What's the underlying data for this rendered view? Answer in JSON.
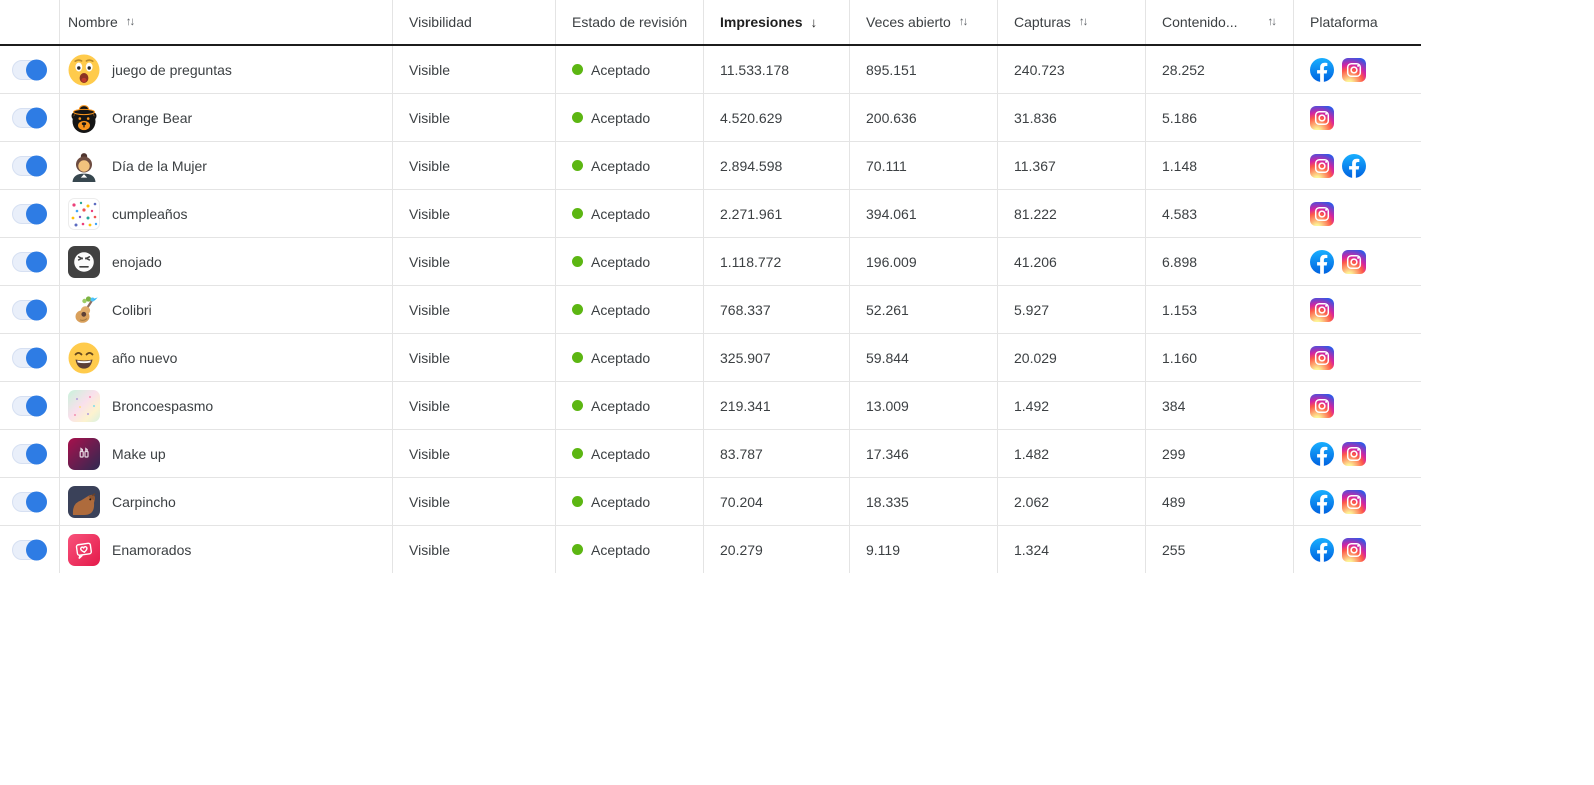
{
  "table": {
    "columns": [
      {
        "id": "nombre",
        "label": "Nombre",
        "sort": "both",
        "sortable": true
      },
      {
        "id": "visibilidad",
        "label": "Visibilidad",
        "sort": "none",
        "sortable": false
      },
      {
        "id": "estado-de-revision",
        "label": "Estado de revisión",
        "sort": "none",
        "sortable": false
      },
      {
        "id": "impresiones",
        "label": "Impresiones",
        "sort": "desc",
        "sortable": true,
        "active": true
      },
      {
        "id": "veces-abierto",
        "label": "Veces abierto",
        "sort": "both",
        "sortable": true
      },
      {
        "id": "capturas",
        "label": "Capturas",
        "sort": "both",
        "sortable": true
      },
      {
        "id": "contenido",
        "label": "Contenido...",
        "sort": "both",
        "sortable": true,
        "sort_right": true
      },
      {
        "id": "plataforma",
        "label": "Plataforma",
        "sort": "none",
        "sortable": false
      }
    ],
    "rows": [
      {
        "enabled": true,
        "avatar": "astonished-face",
        "name": "juego de preguntas",
        "visibility": "Visible",
        "status": "Aceptado",
        "impressions": "11.533.178",
        "opens": "895.151",
        "captures": "240.723",
        "content": "28.252",
        "platforms": [
          "facebook",
          "instagram"
        ]
      },
      {
        "enabled": true,
        "avatar": "orange-bear",
        "name": "Orange Bear",
        "visibility": "Visible",
        "status": "Aceptado",
        "impressions": "4.520.629",
        "opens": "200.636",
        "captures": "31.836",
        "content": "5.186",
        "platforms": [
          "instagram"
        ]
      },
      {
        "enabled": true,
        "avatar": "businesswoman",
        "name": "Día de la Mujer",
        "visibility": "Visible",
        "status": "Aceptado",
        "impressions": "2.894.598",
        "opens": "70.111",
        "captures": "11.367",
        "content": "1.148",
        "platforms": [
          "instagram",
          "facebook"
        ]
      },
      {
        "enabled": true,
        "avatar": "confetti",
        "name": "cumpleaños",
        "visibility": "Visible",
        "status": "Aceptado",
        "impressions": "2.271.961",
        "opens": "394.061",
        "captures": "81.222",
        "content": "4.583",
        "platforms": [
          "instagram"
        ]
      },
      {
        "enabled": true,
        "avatar": "angry-face",
        "name": "enojado",
        "visibility": "Visible",
        "status": "Aceptado",
        "impressions": "1.118.772",
        "opens": "196.009",
        "captures": "41.206",
        "content": "6.898",
        "platforms": [
          "facebook",
          "instagram"
        ]
      },
      {
        "enabled": true,
        "avatar": "guitar-hummingbird",
        "name": "Colibri",
        "visibility": "Visible",
        "status": "Aceptado",
        "impressions": "768.337",
        "opens": "52.261",
        "captures": "5.927",
        "content": "1.153",
        "platforms": [
          "instagram"
        ]
      },
      {
        "enabled": true,
        "avatar": "laughing-face",
        "name": "año nuevo",
        "visibility": "Visible",
        "status": "Aceptado",
        "impressions": "325.907",
        "opens": "59.844",
        "captures": "20.029",
        "content": "1.160",
        "platforms": [
          "instagram"
        ]
      },
      {
        "enabled": true,
        "avatar": "pastel-gradient",
        "name": "Broncoespasmo",
        "visibility": "Visible",
        "status": "Aceptado",
        "impressions": "219.341",
        "opens": "13.009",
        "captures": "1.492",
        "content": "384",
        "platforms": [
          "instagram"
        ]
      },
      {
        "enabled": true,
        "avatar": "makeup",
        "name": "Make up",
        "visibility": "Visible",
        "status": "Aceptado",
        "impressions": "83.787",
        "opens": "17.346",
        "captures": "1.482",
        "content": "299",
        "platforms": [
          "facebook",
          "instagram"
        ]
      },
      {
        "enabled": true,
        "avatar": "capybara",
        "name": "Carpincho",
        "visibility": "Visible",
        "status": "Aceptado",
        "impressions": "70.204",
        "opens": "18.335",
        "captures": "2.062",
        "content": "489",
        "platforms": [
          "facebook",
          "instagram"
        ]
      },
      {
        "enabled": true,
        "avatar": "love-message",
        "name": "Enamorados",
        "visibility": "Visible",
        "status": "Aceptado",
        "impressions": "20.279",
        "opens": "9.119",
        "captures": "1.324",
        "content": "255",
        "platforms": [
          "facebook",
          "instagram"
        ]
      }
    ]
  },
  "icons": {
    "sort_both": "↑↓",
    "sort_desc": "↓"
  },
  "colors": {
    "toggle_on": "#2E7CE4",
    "toggle_track": "#E9EFFA",
    "status_accepted": "#5CB612",
    "facebook_blue": "#0062E0",
    "instagram_pink": "#D6249F",
    "header_border": "#1C1C1C",
    "row_divider": "#E4E4E4"
  }
}
